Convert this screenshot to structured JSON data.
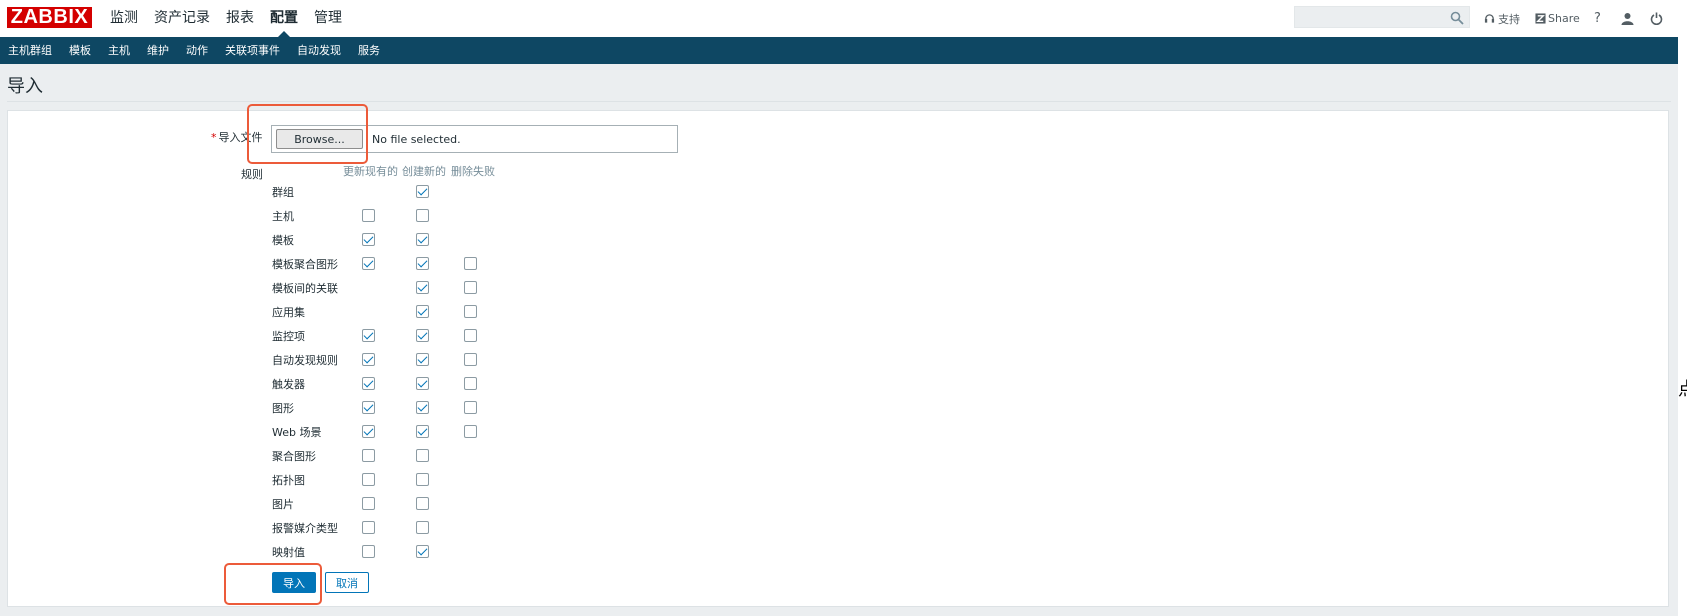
{
  "header": {
    "logo": "ZABBIX",
    "main_nav": [
      {
        "label": "监测",
        "active": false
      },
      {
        "label": "资产记录",
        "active": false
      },
      {
        "label": "报表",
        "active": false
      },
      {
        "label": "配置",
        "active": true
      },
      {
        "label": "管理",
        "active": false
      }
    ],
    "search": {
      "value": "",
      "placeholder": ""
    },
    "support_label": "支持",
    "share_label": "Share",
    "help_glyph": "?"
  },
  "sub_nav": [
    "主机群组",
    "模板",
    "主机",
    "维护",
    "动作",
    "关联项事件",
    "自动发现",
    "服务"
  ],
  "page": {
    "title": "导入",
    "file_label": "导入文件",
    "required_mark": "*",
    "browse_label": "Browse...",
    "file_status": "No file selected.",
    "rules_label": "规则",
    "columns": {
      "update": "更新现有的",
      "create": "创建新的",
      "delete": "删除失败"
    },
    "rules": [
      {
        "label": "群组",
        "update": null,
        "create": true,
        "delete": null
      },
      {
        "label": "主机",
        "update": false,
        "create": false,
        "delete": null
      },
      {
        "label": "模板",
        "update": true,
        "create": true,
        "delete": null
      },
      {
        "label": "模板聚合图形",
        "update": true,
        "create": true,
        "delete": false
      },
      {
        "label": "模板间的关联",
        "update": null,
        "create": true,
        "delete": false
      },
      {
        "label": "应用集",
        "update": null,
        "create": true,
        "delete": false
      },
      {
        "label": "监控项",
        "update": true,
        "create": true,
        "delete": false
      },
      {
        "label": "自动发现规则",
        "update": true,
        "create": true,
        "delete": false
      },
      {
        "label": "触发器",
        "update": true,
        "create": true,
        "delete": false
      },
      {
        "label": "图形",
        "update": true,
        "create": true,
        "delete": false
      },
      {
        "label": "Web 场景",
        "update": true,
        "create": true,
        "delete": false
      },
      {
        "label": "聚合图形",
        "update": false,
        "create": false,
        "delete": null
      },
      {
        "label": "拓扑图",
        "update": false,
        "create": false,
        "delete": null
      },
      {
        "label": "图片",
        "update": false,
        "create": false,
        "delete": null
      },
      {
        "label": "报警媒介类型",
        "update": false,
        "create": false,
        "delete": null
      },
      {
        "label": "映射值",
        "update": false,
        "create": true,
        "delete": null
      }
    ],
    "import_label": "导入",
    "cancel_label": "取消"
  },
  "edge_glyph": "点",
  "colors": {
    "header_bg": "#0e4763",
    "accent": "#0275b8",
    "logo_red": "#d40000",
    "highlight": "#ec5b3a"
  }
}
